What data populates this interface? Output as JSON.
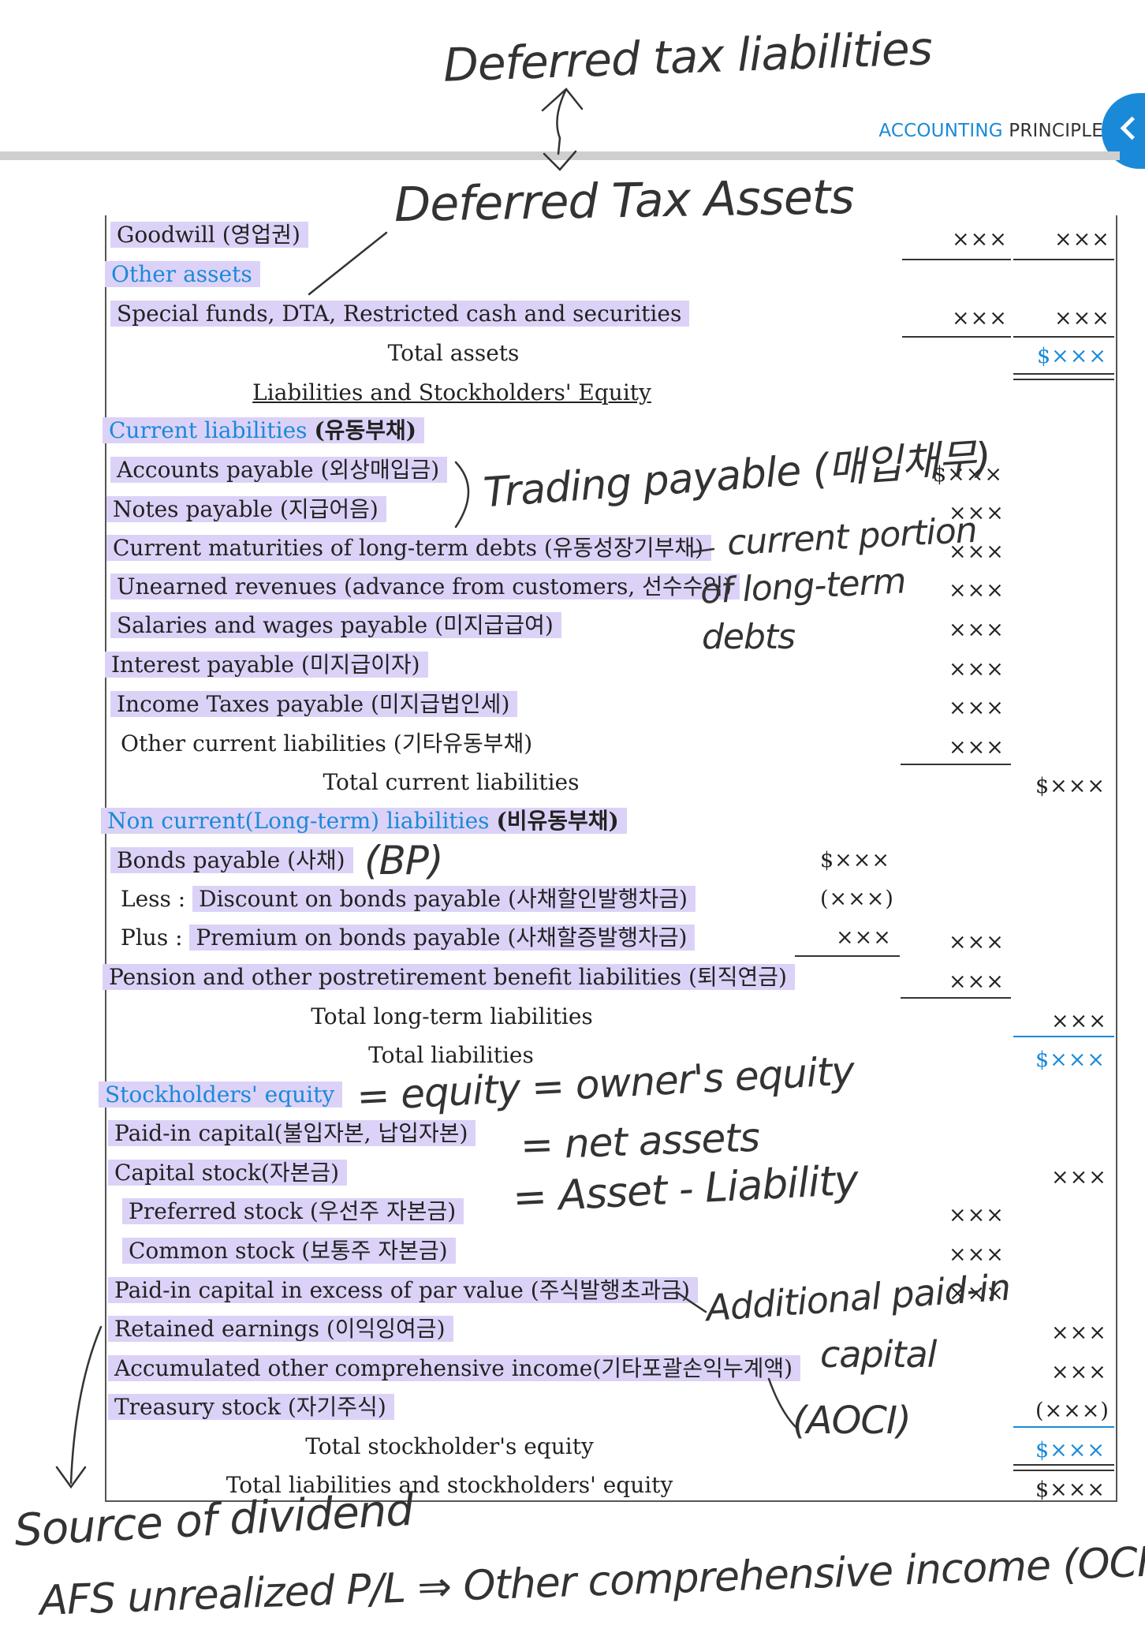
{
  "header": {
    "brand_part1": "ACCOUNTING",
    "brand_part2": "PRINCIPLE"
  },
  "rows": {
    "goodwill": "Goodwill (영업권)",
    "other_assets": "Other assets",
    "special_funds": "Special funds, DTA, Restricted cash and securities",
    "total_assets": "Total assets",
    "section_title": "Liabilities and Stockholders' Equity",
    "current_liabilities": "Current liabilities",
    "current_liabilities_kr": "(유동부채)",
    "accounts_payable": "Accounts payable (외상매입금)",
    "notes_payable": "Notes payable (지급어음)",
    "current_maturities": "Current maturities of long-term debts (유동성장기부채)",
    "unearned_revenues": "Unearned revenues (advance from customers, 선수수익)",
    "salaries_payable": "Salaries and wages payable (미지급급여)",
    "interest_payable": "Interest payable (미지급이자)",
    "income_taxes_payable": "Income Taxes payable (미지급법인세)",
    "other_current": "Other current liabilities (기타유동부채)",
    "total_current": "Total current liabilities",
    "noncurrent": "Non current(Long-term) liabilities",
    "noncurrent_kr": "(비유동부채)",
    "bonds_payable": "Bonds payable (사채)",
    "less_label": "Less :",
    "discount": "Discount on bonds payable (사채할인발행차금)",
    "plus_label": "Plus :",
    "premium": "Premium on bonds payable (사채할증발행차금)",
    "pension": "Pension and other postretirement benefit liabilities (퇴직연금)",
    "total_longterm": "Total long-term liabilities",
    "total_liabilities": "Total liabilities",
    "stockholders_equity": "Stockholders' equity",
    "paid_in": "Paid-in capital(불입자본, 납입자본)",
    "capital_stock": "Capital stock(자본금)",
    "preferred": "Preferred stock (우선주 자본금)",
    "common": "Common stock (보통주 자본금)",
    "excess_par": "Paid-in capital in excess of par value (주식발행초과금)",
    "retained": "Retained earnings (이익잉여금)",
    "aoci": "Accumulated other comprehensive income(기타포괄손익누계액)",
    "treasury": "Treasury stock (자기주식)",
    "total_se": "Total stockholder's equity",
    "total_le": "Total liabilities and stockholders' equity"
  },
  "values": {
    "xxx": "×××",
    "dxxx": "$×××",
    "neg": "(×××)"
  },
  "handwriting": {
    "dtl": "Deferred tax liabilities",
    "dta": "Deferred Tax Assets",
    "trading": "Trading payable (매입채무)",
    "cur_portion_1": "current portion",
    "cur_portion_2": "of long-term",
    "cur_portion_3": "debts",
    "bp": "(BP)",
    "eq1": "= equity = owner's equity",
    "eq2": "= net assets",
    "eq3": "= Asset - Liability",
    "apic_1": "Additional paid-in",
    "apic_2": "capital",
    "aoci_abbr": "(AOCI)",
    "source": "Source of dividend",
    "afs": "AFS unrealized P/L ⇒ Other comprehensive income (OCI)"
  },
  "colors": {
    "accent": "#1a8ad8",
    "highlight": "#dcd2f7",
    "rule": "#cfcfcf"
  }
}
